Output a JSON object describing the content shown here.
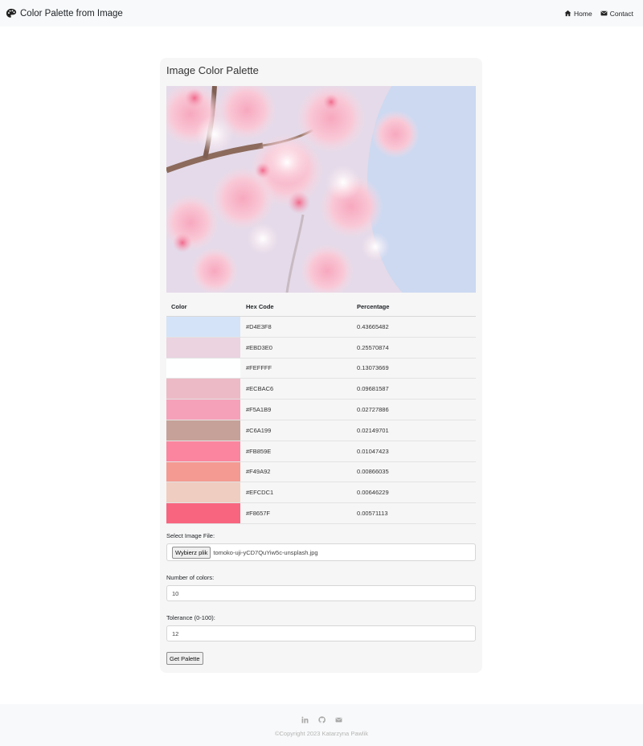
{
  "navbar": {
    "brand": "Color Palette from Image",
    "links": [
      {
        "label": "Home",
        "icon": "home-icon"
      },
      {
        "label": "Contact",
        "icon": "envelope-icon"
      }
    ]
  },
  "card": {
    "title": "Image Color Palette",
    "image_alt_icon": "cherry-blossom-photo"
  },
  "table": {
    "headers": {
      "color": "Color",
      "hex": "Hex Code",
      "percentage": "Percentage"
    },
    "rows": [
      {
        "swatch": "#D4E3F8",
        "hex": "#D4E3F8",
        "percentage": "0.43665482"
      },
      {
        "swatch": "#EBD3E0",
        "hex": "#EBD3E0",
        "percentage": "0.25570874"
      },
      {
        "swatch": "#FEFFFF",
        "hex": "#FEFFFF",
        "percentage": "0.13073669"
      },
      {
        "swatch": "#ECBAC6",
        "hex": "#ECBAC6",
        "percentage": "0.09681587"
      },
      {
        "swatch": "#F5A1B9",
        "hex": "#F5A1B9",
        "percentage": "0.02727886"
      },
      {
        "swatch": "#C6A199",
        "hex": "#C6A199",
        "percentage": "0.02149701"
      },
      {
        "swatch": "#FB859E",
        "hex": "#FB859E",
        "percentage": "0.01047423"
      },
      {
        "swatch": "#F49A92",
        "hex": "#F49A92",
        "percentage": "0.00866035"
      },
      {
        "swatch": "#EFCDC1",
        "hex": "#EFCDC1",
        "percentage": "0.00646229"
      },
      {
        "swatch": "#F8657F",
        "hex": "#F8657F",
        "percentage": "0.00571113"
      }
    ]
  },
  "form": {
    "file_label": "Select Image File:",
    "file_button": "Wybierz plik",
    "file_name": "tomoko-uji-yCD7QuYiw5c-unsplash.jpg",
    "colors_label": "Number of colors:",
    "colors_value": "10",
    "tolerance_label": "Tolerance (0-100):",
    "tolerance_value": "12",
    "submit": "Get Palette"
  },
  "footer": {
    "icons": [
      "linkedin-icon",
      "github-icon",
      "envelope-icon"
    ],
    "copyright": "©Copyright 2023 Katarzyna Pawlik"
  }
}
